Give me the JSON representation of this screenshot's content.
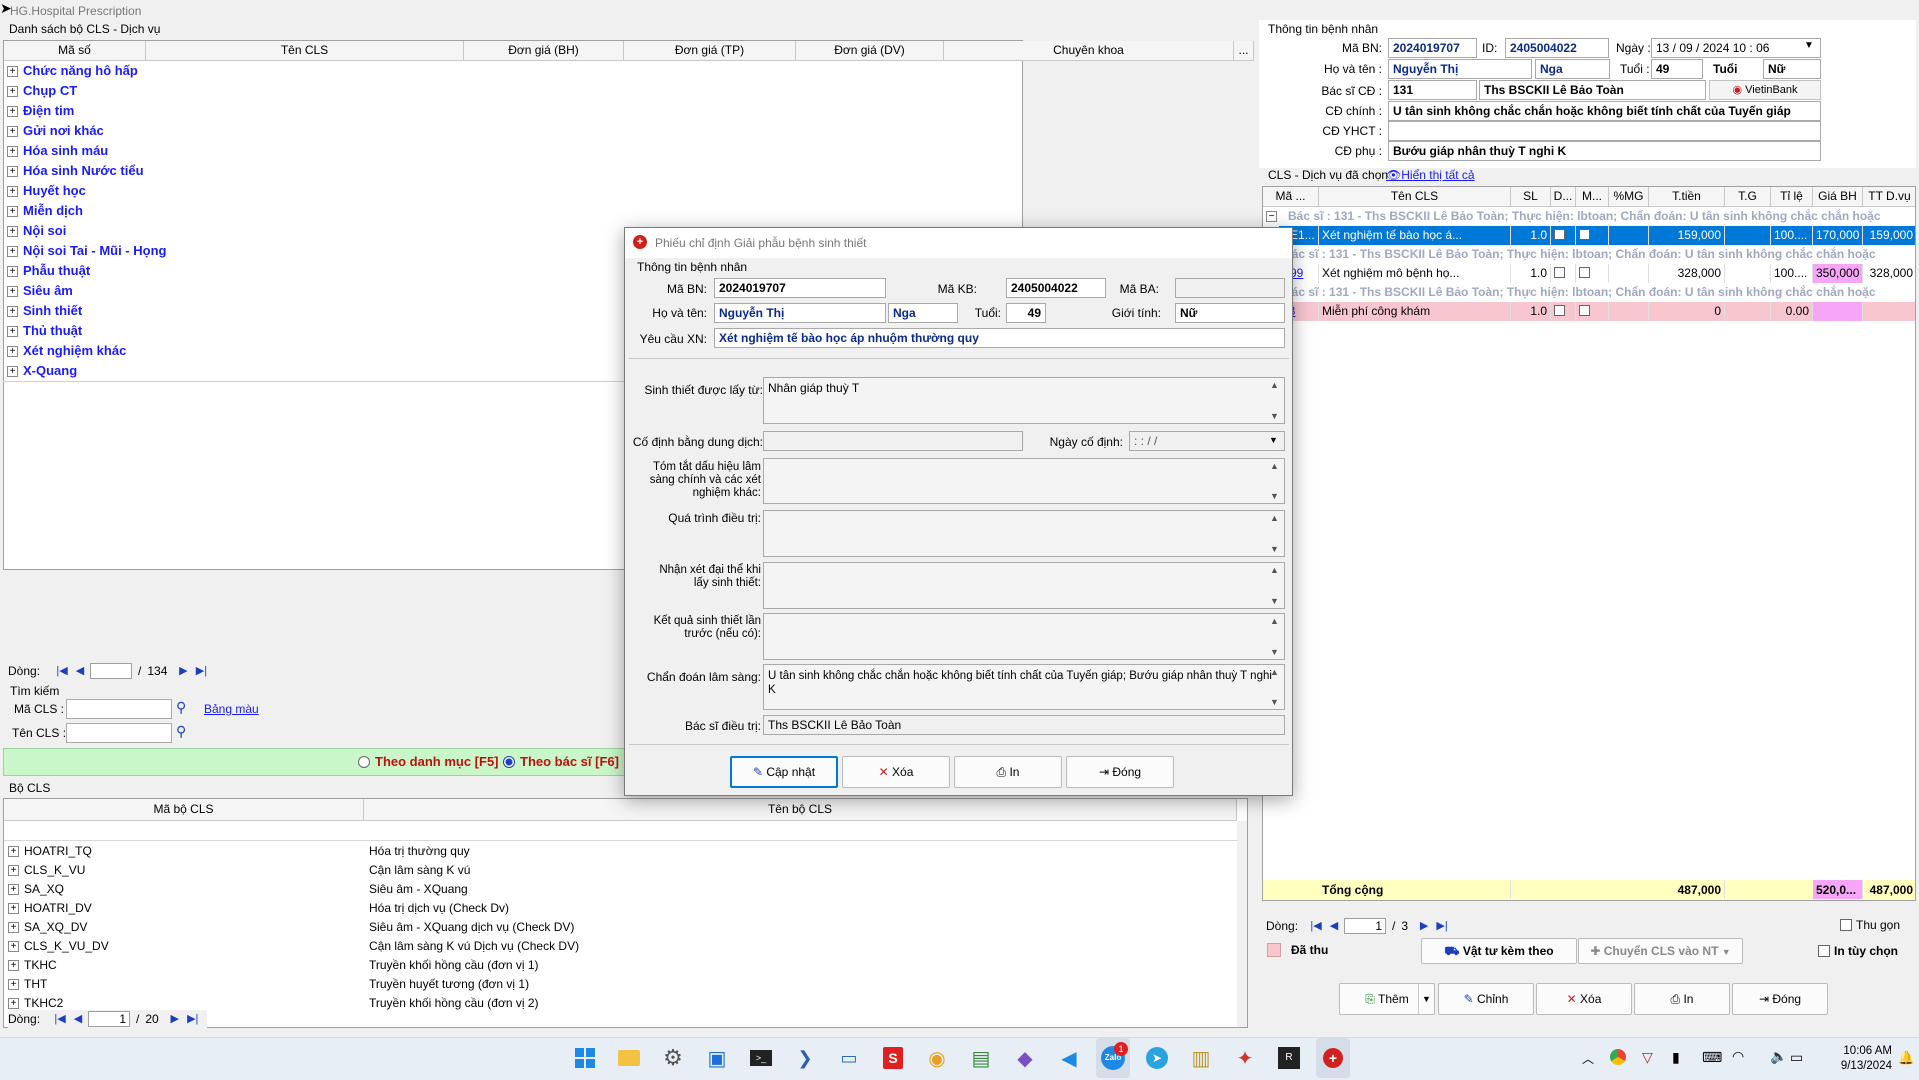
{
  "app_title": "HG.Hospital Prescription",
  "left": {
    "list_title": "Danh sách bộ CLS - Dịch vụ",
    "columns": [
      "Mã số",
      "Tên CLS",
      "Đơn giá (BH)",
      "Đơn giá (TP)",
      "Đơn giá (DV)",
      "Chuyên khoa",
      "..."
    ],
    "categories": [
      "Chức năng hô hấp",
      "Chụp CT",
      "Điện tim",
      "Gửi nơi khác",
      "Hóa sinh máu",
      "Hóa sinh Nước tiểu",
      "Huyết học",
      "Miễn dịch",
      "Nội soi",
      "Nội soi Tai - Mũi - Họng",
      "Phẫu thuật",
      "Siêu âm",
      "Sinh thiết",
      "Thủ thuật",
      "Xét nghiệm khác",
      "X-Quang"
    ],
    "pager": {
      "label": "Dòng:",
      "current": "",
      "total": "134"
    },
    "search": {
      "title": "Tìm kiếm",
      "ma_label": "Mã CLS :",
      "ten_label": "Tên CLS :",
      "bang_mau": "Bảng màu",
      "ma_value": "",
      "ten_value": ""
    },
    "radio": {
      "opt1": "Theo danh mục [F5]",
      "opt2": "Theo bác sĩ  [F6]"
    },
    "bo_cls": {
      "title": "Bộ CLS",
      "col1": "Mã bộ CLS",
      "col2": "Tên bộ CLS",
      "rows": [
        {
          "code": "HOATRI_TQ",
          "name": "Hóa trị thường quy"
        },
        {
          "code": "CLS_K_VU",
          "name": "Cận lâm sàng K vú"
        },
        {
          "code": "SA_XQ",
          "name": "Siêu âm - XQuang"
        },
        {
          "code": "HOATRI_DV",
          "name": "Hóa trị dịch vụ (Check Dv)"
        },
        {
          "code": "SA_XQ_DV",
          "name": "Siêu âm - XQuang dịch vụ (Check DV)"
        },
        {
          "code": "CLS_K_VU_DV",
          "name": "Cận lâm sàng K vú Dịch vụ (Check DV)"
        },
        {
          "code": "TKHC",
          "name": "Truyền khối hồng cầu (đơn vị 1)"
        },
        {
          "code": "THT",
          "name": "Truyền huyết tương (đơn vị 1)"
        },
        {
          "code": "TKHC2",
          "name": "Truyền khối hồng cầu (đơn vị 2)"
        }
      ],
      "pager": {
        "label": "Dòng:",
        "current": "1",
        "total": "20"
      }
    }
  },
  "patient": {
    "title": "Thông tin bệnh nhân",
    "ma_bn_label": "Mã BN:",
    "ma_bn": "2024019707",
    "id_label": "ID:",
    "id": "2405004022",
    "ngay_label": "Ngày :",
    "ngay": "13 / 09 / 2024    10 : 06",
    "ho_ten_label": "Họ và tên :",
    "ho": "Nguyễn Thị",
    "ten": "Nga",
    "tuoi_label": "Tuổi :",
    "tuoi": "49",
    "tuoi_unit": "Tuổi",
    "gioi": "Nữ",
    "bs_label": "Bác sĩ CĐ :",
    "bs_code": "131",
    "bs_name": "Ths BSCKII Lê Bảo Toàn",
    "bank": "VietinBank",
    "cd_chinh_label": "CĐ chính :",
    "cd_chinh": "U tân sinh không chắc chắn hoặc không biết tính chất của Tuyến giáp",
    "cd_yhct_label": "CĐ YHCT :",
    "cd_yhct": "",
    "cd_phu_label": "CĐ phụ :",
    "cd_phu": "Bướu giáp nhân thuỳ T nghi K"
  },
  "selected": {
    "title": "CLS - Dịch vụ đã chọn",
    "show_all": "Hiển thị tất cả",
    "columns": [
      "Mã ...",
      "Tên CLS",
      "SL",
      "D...",
      "M...",
      "%MG",
      "T.tiền",
      "T.G",
      "Tỉ lệ",
      "Giá BH",
      "TT D.vụ"
    ],
    "group_text": "Bác sĩ :  131 - Ths BSCKII Lê Bảo Toàn; Thực hiện: lbtoan; Chẩn đoán: U tân sinh không chắc chắn hoặc",
    "rows": [
      {
        "ma": "XE1...",
        "ten": "Xét nghiệm tế bào học á...",
        "sl": "1.0",
        "ttien": "159,000",
        "tile": "100....",
        "giabh": "170,000",
        "ttdv": "159,000"
      },
      {
        "ma": "E99",
        "ten": "Xét nghiệm mô bệnh họ...",
        "sl": "1.0",
        "ttien": "328,000",
        "tile": "100....",
        "giabh": "350,000",
        "ttdv": "328,000"
      },
      {
        "ma": "03",
        "ten": "Miễn phí công khám",
        "sl": "1.0",
        "ttien": "0",
        "tile": "0.00",
        "giabh": "",
        "ttdv": ""
      }
    ],
    "total_label": "Tổng cộng",
    "total_ttien": "487,000",
    "total_giabh": "520,0...",
    "total_ttdv": "487,000",
    "pager": {
      "label": "Dòng:",
      "current": "1",
      "total": "3"
    },
    "thu_gon": "Thu gọn",
    "da_thu": "Đã thu",
    "vat_tu": "Vật tư kèm theo",
    "chuyen": "Chuyển CLS vào NT",
    "in_tuy_chon": "In tùy chọn",
    "btn_them": "Thêm",
    "btn_chinh": "Chỉnh",
    "btn_xoa": "Xóa",
    "btn_in": "In",
    "btn_dong": "Đóng"
  },
  "dialog": {
    "title": "Phiếu chỉ định Giải phẫu bệnh sinh thiết",
    "section": "Thông tin bệnh nhân",
    "ma_bn_label": "Mã BN:",
    "ma_bn": "2024019707",
    "ma_kb_label": "Mã KB:",
    "ma_kb": "2405004022",
    "ma_ba_label": "Mã BA:",
    "ma_ba": "",
    "ho_ten_label": "Họ và tên:",
    "ho": "Nguyễn Thị",
    "ten": "Nga",
    "tuoi_label": "Tuổi:",
    "tuoi": "49",
    "gioi_label": "Giới tính:",
    "gioi": "Nữ",
    "yeu_cau_label": "Yêu cầu XN:",
    "yeu_cau": "Xét nghiệm tế bào học áp nhuộm thường quy",
    "sinh_thiet_label": "Sinh thiết được lấy từ:",
    "sinh_thiet": "Nhân giáp thuỳ T",
    "co_dinh_label": "Cố định bằng dung dịch:",
    "co_dinh": "",
    "ngay_co_dinh_label": "Ngày cố định:",
    "ngay_co_dinh": "  :   :         /    /",
    "tom_tat_label": "Tóm tắt dấu hiệu lâm sàng chính và các xét nghiệm khác:",
    "tom_tat": "",
    "qua_trinh_label": "Quá trình điều trị:",
    "qua_trinh": "",
    "nhan_xet_label": "Nhận xét đại thể khi lấy sinh thiết:",
    "nhan_xet": "",
    "ket_qua_label": "Kết quả sinh thiết lần trước (nếu có):",
    "ket_qua": "",
    "chan_doan_label": "Chẩn đoán lâm sàng:",
    "chan_doan": "U tân sinh không chắc chắn hoặc không biết tính chất của Tuyến giáp; Bướu giáp nhân thuỳ T nghi K",
    "bs_label": "Bác sĩ điều trị:",
    "bs": "Ths BSCKII Lê Bảo Toàn",
    "btn_cap_nhat": "Cập nhật",
    "btn_xoa": "Xóa",
    "btn_in": "In",
    "btn_dong": "Đóng"
  },
  "taskbar": {
    "time": "10:06 AM",
    "date": "9/13/2024",
    "badge": "1"
  },
  "colors": {
    "accent": "#0078d7",
    "link": "#1a1aff",
    "pink_row": "#f7c6cf",
    "green_bar": "#c9f7c9",
    "total_bar": "#ffffc0"
  }
}
